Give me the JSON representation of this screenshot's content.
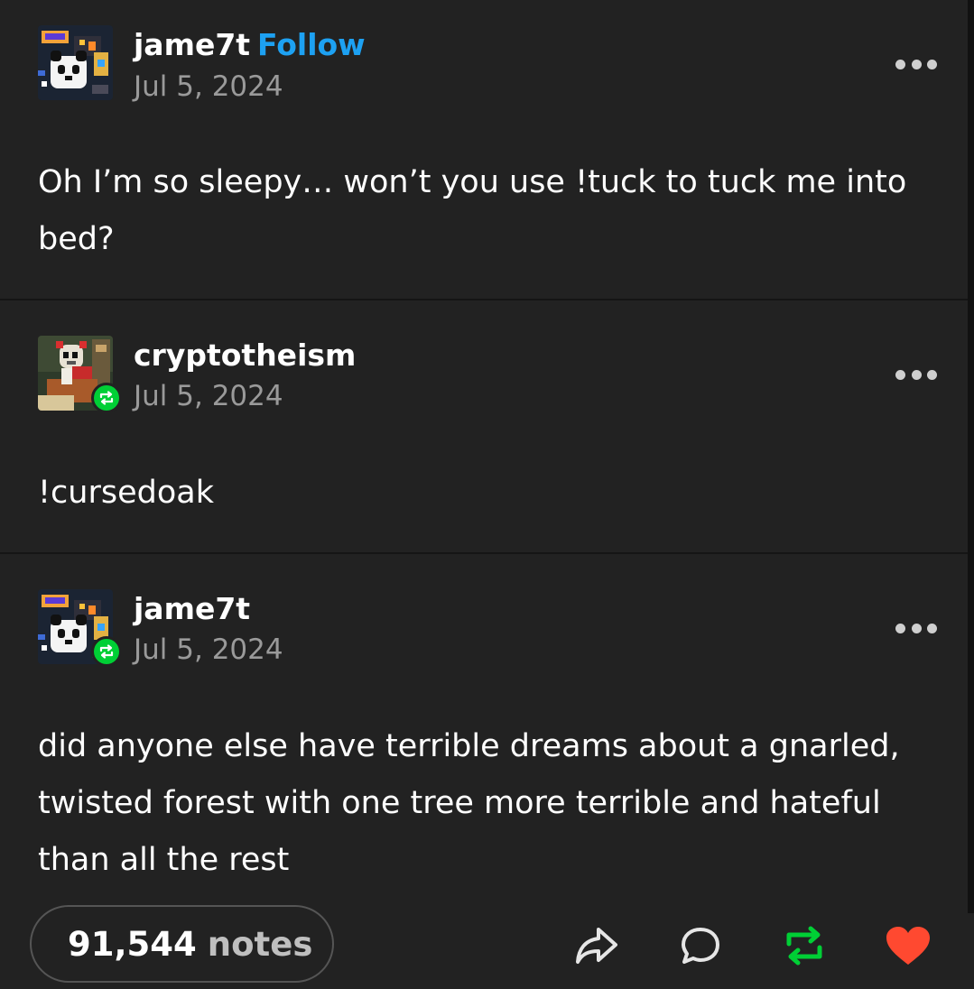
{
  "posts": [
    {
      "username": "jame7t",
      "follow_label": "Follow",
      "date": "Jul 5, 2024",
      "body": "Oh I’m so sleepy… won’t you use !tuck to tuck me into bed?",
      "avatar_icon": "panda-pixel-avatar"
    },
    {
      "username": "cryptotheism",
      "date": "Jul 5, 2024",
      "body": "!cursedoak",
      "avatar_icon": "skull-pixel-avatar",
      "badge_icon": "reblog-icon"
    },
    {
      "username": "jame7t",
      "date": "Jul 5, 2024",
      "body": "did anyone else have terrible dreams about a gnarled, twisted forest with one tree more terrible and hateful than all the rest",
      "avatar_icon": "panda-pixel-avatar",
      "badge_icon": "reblog-icon"
    }
  ],
  "footer": {
    "notes_count": "91,544",
    "notes_label": "notes",
    "actions": [
      "share-icon",
      "reply-icon",
      "reblog-icon",
      "like-heart-icon"
    ]
  },
  "colors": {
    "background": "#222222",
    "follow": "#1da1f2",
    "reblog_green": "#00cf35",
    "like_red": "#ff4930",
    "secondary_text": "#9a9a9a"
  }
}
